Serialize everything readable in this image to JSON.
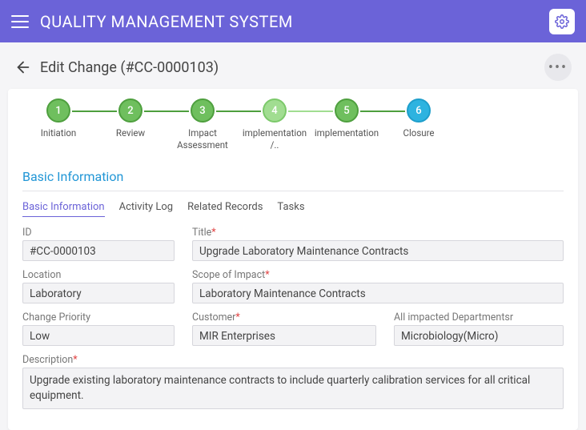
{
  "header": {
    "title": "QUALITY MANAGEMENT SYSTEM"
  },
  "page": {
    "title": "Edit Change (#CC-0000103)"
  },
  "stepper": [
    {
      "num": "1",
      "label": "Initiation"
    },
    {
      "num": "2",
      "label": "Review"
    },
    {
      "num": "3",
      "label": "Impact Assessment"
    },
    {
      "num": "4",
      "label": "implementation /.."
    },
    {
      "num": "5",
      "label": "implementation"
    },
    {
      "num": "6",
      "label": "Closure"
    }
  ],
  "section": {
    "title": "Basic Information"
  },
  "tabs": {
    "basic": "Basic Information",
    "activity": "Activity Log",
    "related": "Related Records",
    "tasks": "Tasks"
  },
  "fields": {
    "id": {
      "label": "ID",
      "value": "#CC-0000103"
    },
    "title": {
      "label": "Title",
      "value": "Upgrade Laboratory Maintenance Contracts"
    },
    "location": {
      "label": "Location",
      "value": "Laboratory"
    },
    "scope": {
      "label": "Scope of Impact",
      "value": "Laboratory Maintenance Contracts"
    },
    "priority": {
      "label": "Change Priority",
      "value": "Low"
    },
    "customer": {
      "label": "Customer",
      "value": "MIR Enterprises"
    },
    "departments": {
      "label": "All impacted Departmentsr",
      "value": "Microbiology(Micro)"
    },
    "description": {
      "label": "Description",
      "value": "Upgrade existing laboratory maintenance contracts to include quarterly calibration services for all critical equipment."
    }
  }
}
